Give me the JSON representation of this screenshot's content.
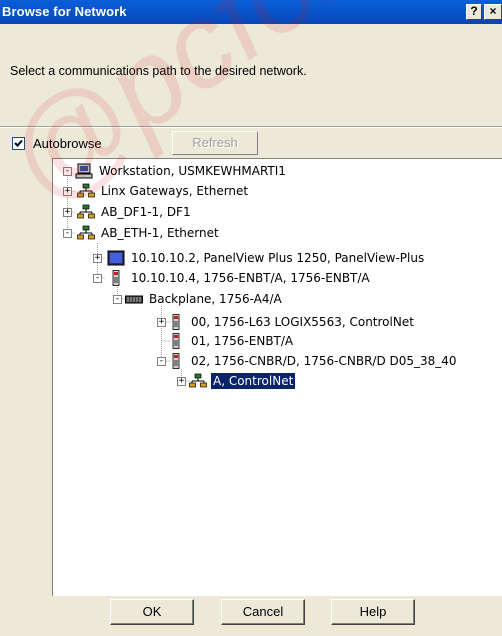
{
  "window": {
    "title": "Browse for Network",
    "help_glyph": "?",
    "close_glyph": "×"
  },
  "instruction": "Select a communications path to the desired network.",
  "autobrowse": {
    "label": "Autobrowse",
    "checked": true
  },
  "refresh_label": "Refresh",
  "tree": {
    "nodes": [
      {
        "label": "Workstation, USMKEWHMARTI1",
        "icon": "computer-icon",
        "expander": "-"
      },
      {
        "label": "Linx Gateways, Ethernet",
        "icon": "network-icon",
        "expander": "+"
      },
      {
        "label": "AB_DF1-1, DF1",
        "icon": "network-icon",
        "expander": "+"
      },
      {
        "label": "AB_ETH-1, Ethernet",
        "icon": "network-icon",
        "expander": "-"
      },
      {
        "label": "10.10.10.2, PanelView Plus 1250, PanelView-Plus",
        "icon": "panelview-icon",
        "expander": "+"
      },
      {
        "label": "10.10.10.4, 1756-ENBT/A, 1756-ENBT/A",
        "icon": "module-icon",
        "expander": "-"
      },
      {
        "label": "Backplane, 1756-A4/A",
        "icon": "backplane-icon",
        "expander": "-"
      },
      {
        "label": "00, 1756-L63 LOGIX5563, ControlNet",
        "icon": "module-icon",
        "expander": "+"
      },
      {
        "label": "01, 1756-ENBT/A",
        "icon": "module-icon",
        "expander": ""
      },
      {
        "label": "02, 1756-CNBR/D, 1756-CNBR/D D05_38_40",
        "icon": "module-icon",
        "expander": "-"
      },
      {
        "label": "A, ControlNet",
        "icon": "network-icon",
        "expander": "+",
        "selected": true
      }
    ]
  },
  "buttons": {
    "ok": "OK",
    "cancel": "Cancel",
    "help": "Help"
  },
  "watermark_text": "@pcforgeeks",
  "colors": {
    "titlebar": "#0846b8",
    "dialog_bg": "#ece9d8",
    "selection": "#0a246a",
    "watermark": "#dc1e28"
  }
}
